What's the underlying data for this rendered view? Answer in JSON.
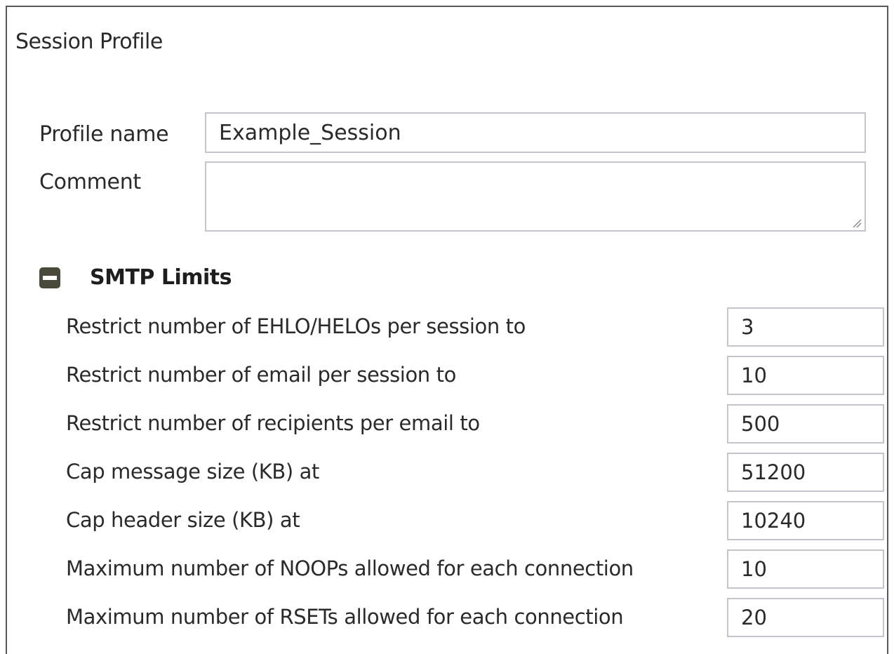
{
  "panel": {
    "title": "Session Profile"
  },
  "form": {
    "profile_name_label": "Profile name",
    "profile_name_value": "Example_Session",
    "comment_label": "Comment",
    "comment_value": ""
  },
  "smtp_limits": {
    "title": "SMTP Limits",
    "expanded": true,
    "toggle_icon": "minus-square-icon",
    "rows": [
      {
        "label": "Restrict number of EHLO/HELOs per session to",
        "value": "3"
      },
      {
        "label": "Restrict number of email per session to",
        "value": "10"
      },
      {
        "label": "Restrict number of recipients per email to",
        "value": "500"
      },
      {
        "label": "Cap message size (KB) at",
        "value": "51200"
      },
      {
        "label": "Cap header size (KB) at",
        "value": "10240"
      },
      {
        "label": "Maximum number of NOOPs allowed for each connection",
        "value": "10"
      },
      {
        "label": "Maximum number of RSETs allowed for each connection",
        "value": "20"
      }
    ]
  },
  "colors": {
    "toggle": "#4a4a3c",
    "input_border": "#c4c4cc",
    "panel_border": "#5a5a5a"
  }
}
